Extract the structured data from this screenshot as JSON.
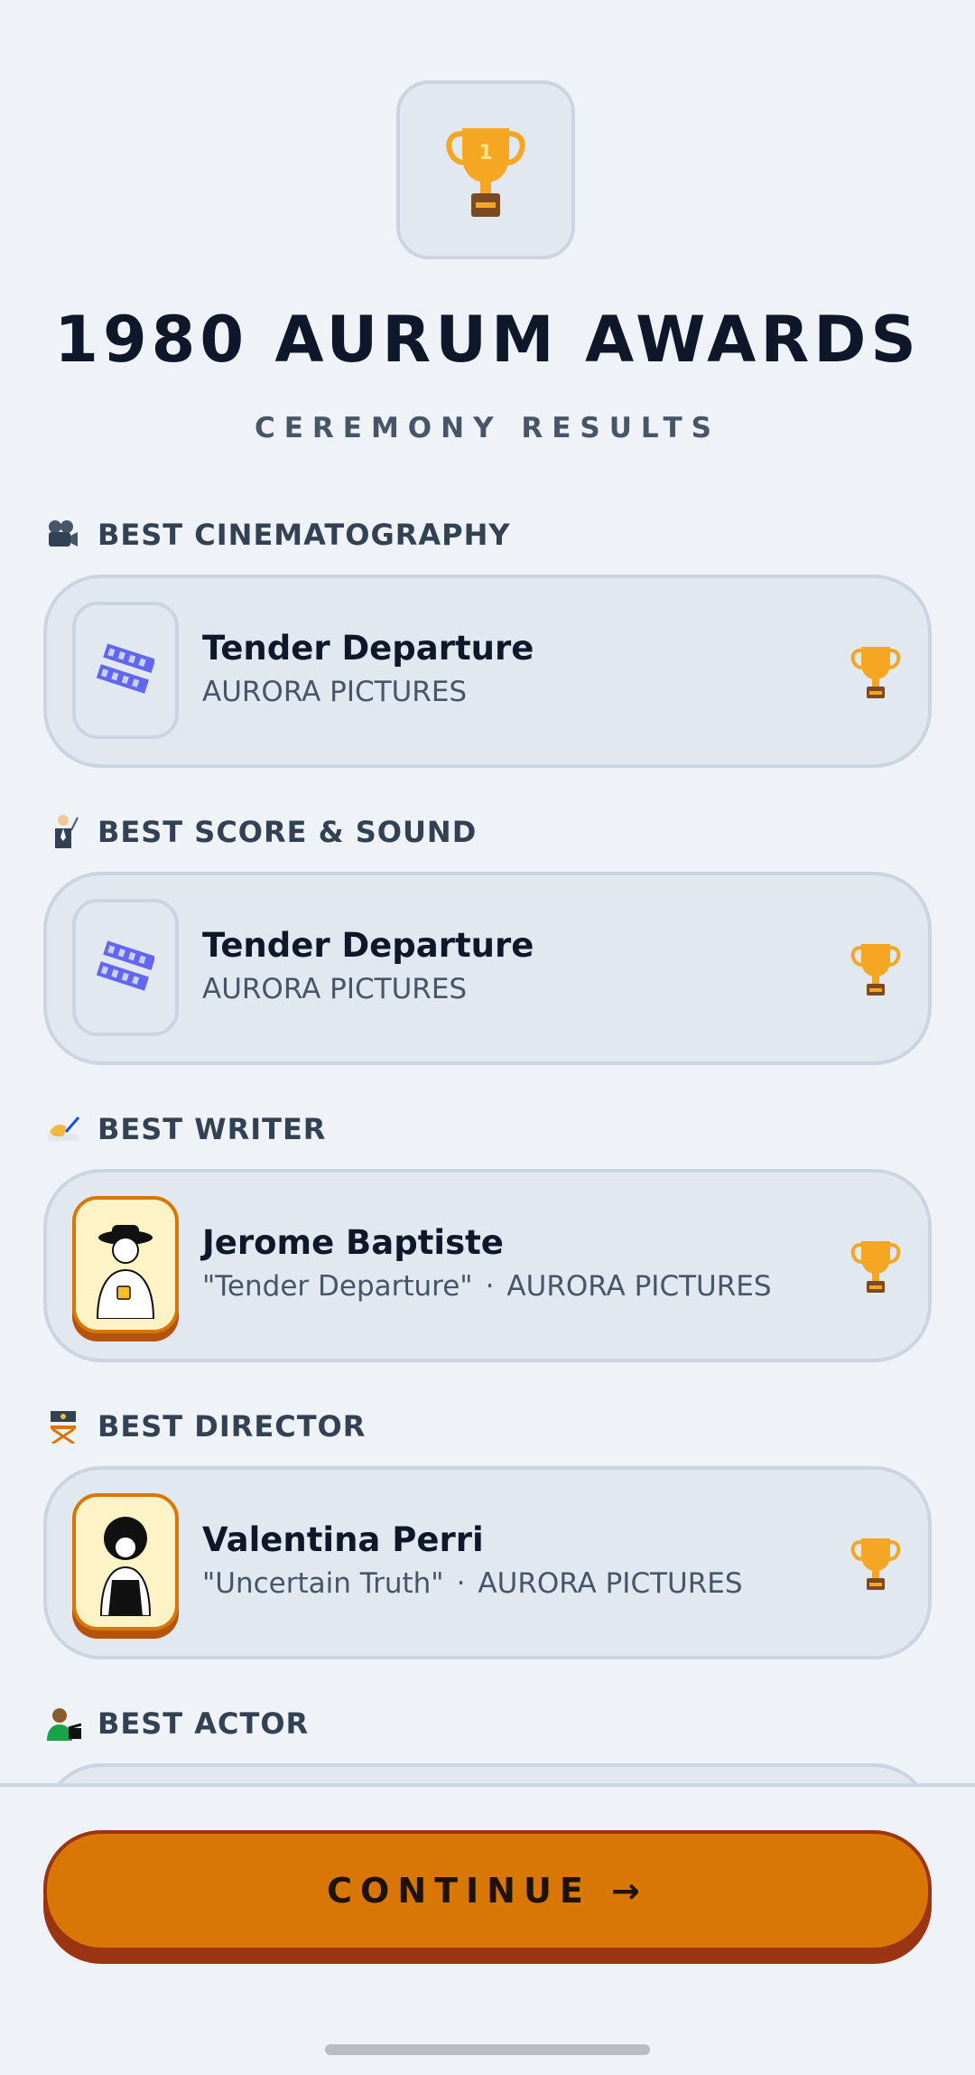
{
  "header": {
    "icon": "trophy-icon",
    "title": "1980 AURUM AWARDS",
    "subtitle": "CEREMONY RESULTS"
  },
  "categories": [
    {
      "label": "BEST CINEMATOGRAPHY",
      "icon": "movie-camera-icon",
      "winner": {
        "type": "film",
        "name": "Tender Departure",
        "meta": "AURORA PICTURES"
      }
    },
    {
      "label": "BEST SCORE & SOUND",
      "icon": "conductor-icon",
      "winner": {
        "type": "film",
        "name": "Tender Departure",
        "meta": "AURORA PICTURES"
      }
    },
    {
      "label": "BEST WRITER",
      "icon": "writing-hand-icon",
      "winner": {
        "type": "person",
        "name": "Jerome Baptiste",
        "film": "\"Tender Departure\"",
        "separator": "·",
        "studio": "AURORA PICTURES"
      }
    },
    {
      "label": "BEST DIRECTOR",
      "icon": "director-chair-icon",
      "winner": {
        "type": "person",
        "name": "Valentina Perri",
        "film": "\"Uncertain Truth\"",
        "separator": "·",
        "studio": "AURORA PICTURES"
      }
    },
    {
      "label": "BEST ACTOR",
      "icon": "actor-icon"
    }
  ],
  "footer": {
    "continue_label": "CONTINUE →"
  },
  "colors": {
    "background": "#eff2f7",
    "card": "#e2e8f0",
    "border": "#cbd5e1",
    "accent": "#d97706",
    "accent_dark": "#9a3412",
    "gold": "#f5a623"
  }
}
